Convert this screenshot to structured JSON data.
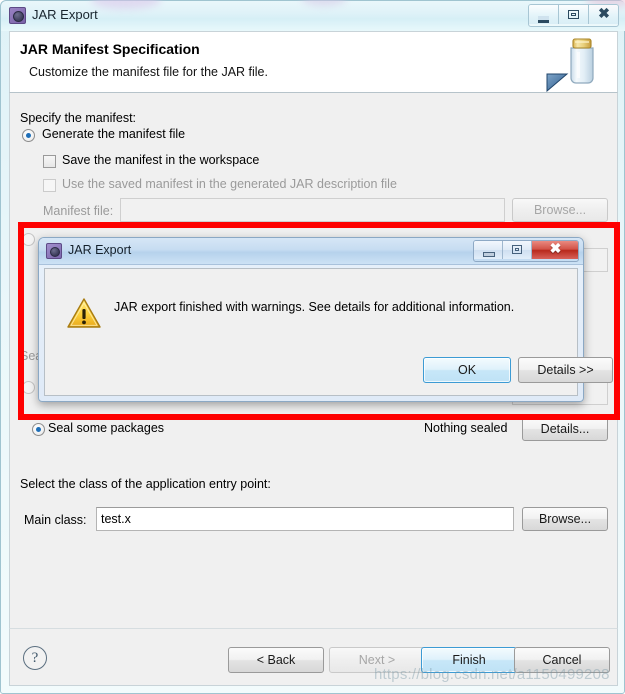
{
  "window": {
    "title": "JAR Export",
    "icon": "jar-export-app-icon",
    "buttons": {
      "minimize": "minimize-icon",
      "maximize": "maximize-icon",
      "close": "close-icon"
    }
  },
  "header": {
    "title": "JAR Manifest Specification",
    "subtitle": "Customize the manifest file for the JAR file.",
    "icon": "jar-banner-icon"
  },
  "body": {
    "manifest_section_label": "Specify the manifest:",
    "generate_radio_label": "Generate the manifest file",
    "save_workspace_checkbox_label": "Save the manifest in the workspace",
    "use_saved_checkbox_label": "Use the saved manifest in the generated JAR description file",
    "manifest_file_label": "Manifest file:",
    "manifest_file_value": "",
    "manifest_browse_label": "Browse...",
    "seal_some_packages_label": "Seal some packages",
    "nothing_sealed_label": "Nothing sealed",
    "seal_details_label": "Details...",
    "entry_point_label": "Select the class of the application entry point:",
    "main_class_label": "Main class:",
    "main_class_value": "test.x",
    "main_class_browse_label": "Browse..."
  },
  "footer": {
    "help_icon": "help-icon",
    "back_label": "< Back",
    "next_label": "Next >",
    "finish_label": "Finish",
    "cancel_label": "Cancel"
  },
  "modal": {
    "title": "JAR Export",
    "icon": "jar-export-app-icon",
    "message": "JAR export finished with warnings. See details for additional information.",
    "warning_icon": "warning-triangle-icon",
    "ok_label": "OK",
    "details_label": "Details >>",
    "buttons": {
      "minimize": "minimize-icon",
      "maximize": "maximize-icon",
      "close": "close-icon"
    }
  },
  "annotation": {
    "color": "#fe0000",
    "shape": "rectangle-highlight"
  },
  "watermark": {
    "text": "https://blog.csdn.net/a1150499208"
  }
}
